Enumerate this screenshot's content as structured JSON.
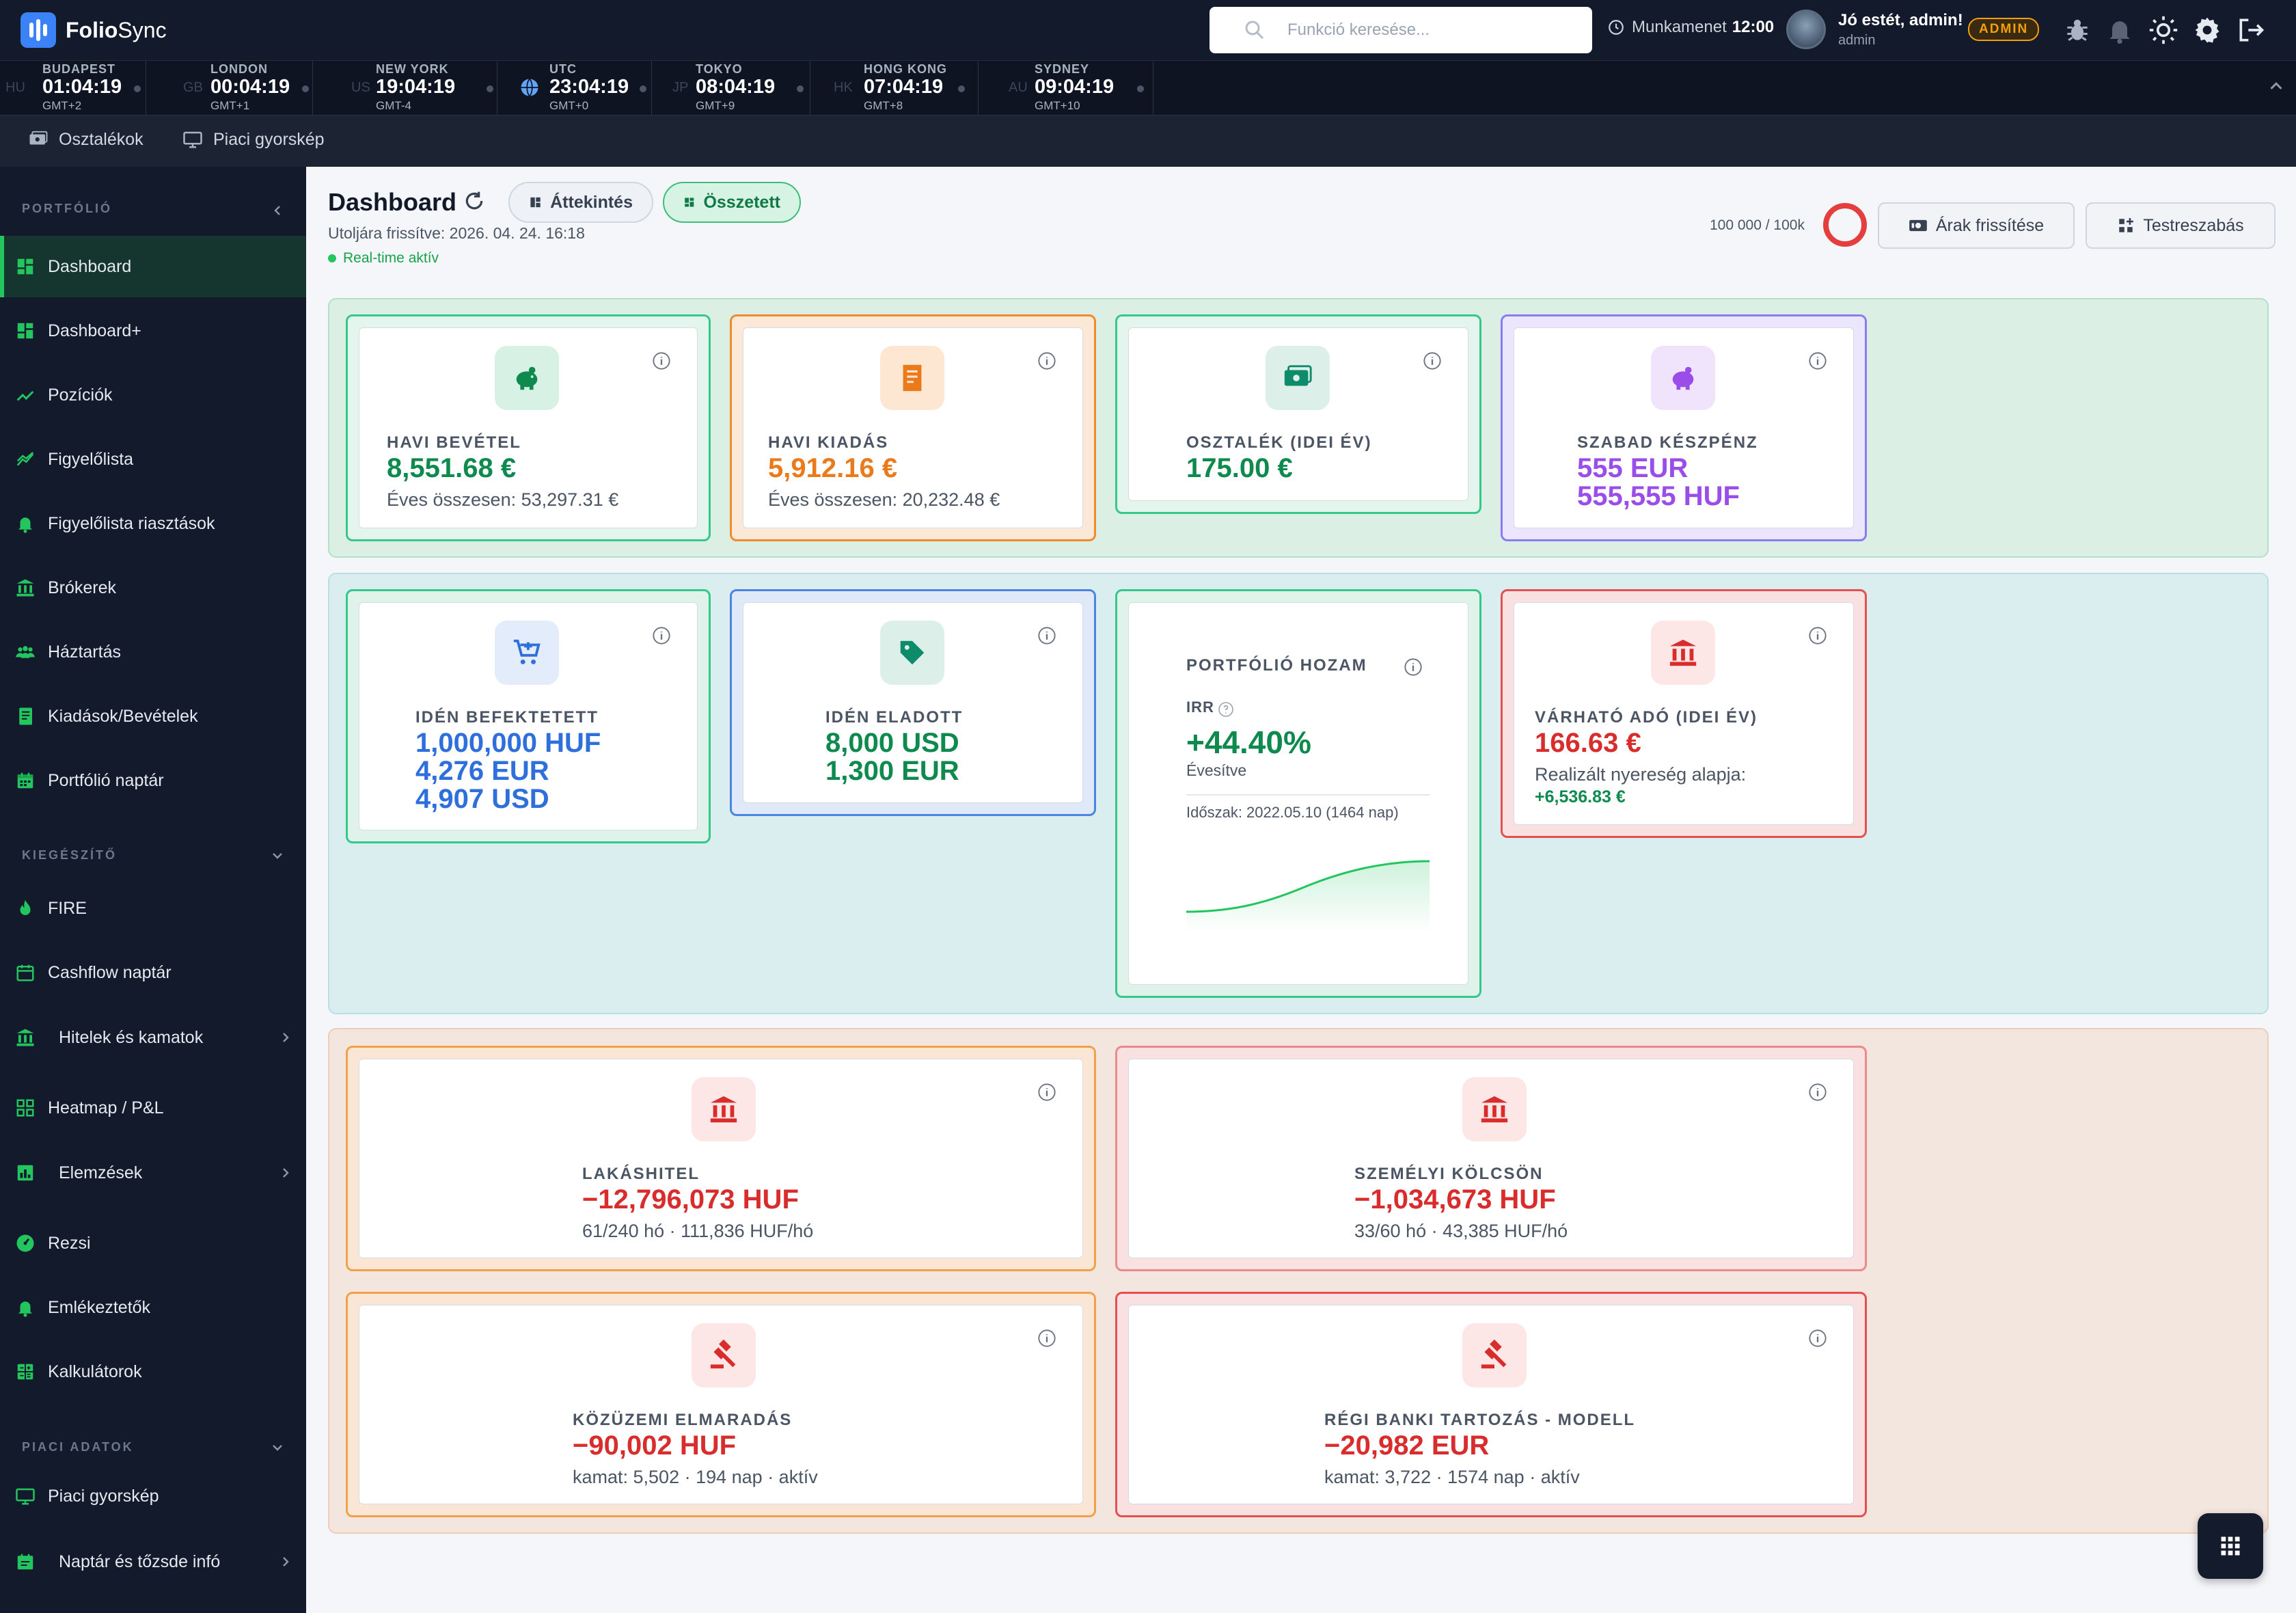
{
  "app": {
    "logo_bold": "Folio",
    "logo_rest": "Sync"
  },
  "search": {
    "placeholder": "Funkció keresése..."
  },
  "session": {
    "label": "Munkamenet",
    "time": "12:00"
  },
  "user": {
    "greeting": "Jó estét, admin!",
    "name": "admin",
    "role": "ADMIN"
  },
  "clocks": [
    {
      "cc": "HU",
      "city": "BUDAPEST",
      "time": "01:04:19",
      "gmt": "GMT+2"
    },
    {
      "cc": "GB",
      "city": "LONDON",
      "time": "00:04:19",
      "gmt": "GMT+1"
    },
    {
      "cc": "US",
      "city": "NEW YORK",
      "time": "19:04:19",
      "gmt": "GMT-4"
    },
    {
      "cc": "",
      "city": "UTC",
      "time": "23:04:19",
      "gmt": "GMT+0"
    },
    {
      "cc": "JP",
      "city": "TOKYO",
      "time": "08:04:19",
      "gmt": "GMT+9"
    },
    {
      "cc": "HK",
      "city": "HONG KONG",
      "time": "07:04:19",
      "gmt": "GMT+8"
    },
    {
      "cc": "AU",
      "city": "SYDNEY",
      "time": "09:04:19",
      "gmt": "GMT+10"
    }
  ],
  "quickbar": {
    "dividends": "Osztalékok",
    "market_snapshot": "Piaci gyorskép"
  },
  "sidebar": {
    "section_portfolio": "PORTFÓLIÓ",
    "section_extra": "KIEGÉSZÍTŐ",
    "section_market": "PIACI ADATOK",
    "items": [
      "Dashboard",
      "Dashboard+",
      "Pozíciók",
      "Figyelőlista",
      "Figyelőlista riasztások",
      "Brókerek",
      "Háztartás",
      "Kiadások/Bevételek",
      "Portfólió naptár",
      "FIRE",
      "Cashflow naptár",
      "Hitelek és kamatok",
      "Heatmap / P&L",
      "Elemzések",
      "Rezsi",
      "Emlékeztetők",
      "Kalkulátorok",
      "Piaci gyorskép",
      "Naptár és tőzsde infó"
    ]
  },
  "header": {
    "title": "Dashboard",
    "tab_overview": "Áttekintés",
    "tab_combined": "Összetett",
    "updated": "Utoljára frissítve: 2026. 04. 24. 16:18",
    "realtime": "Real-time aktív",
    "quota": "100 000 / 100k",
    "refresh_prices": "Árak frissítése",
    "customize": "Testreszabás"
  },
  "cards": {
    "income": {
      "label": "HAVI BEVÉTEL",
      "value": "8,551.68 €",
      "sub": "Éves összesen: 53,297.31 €"
    },
    "expense": {
      "label": "HAVI KIADÁS",
      "value": "5,912.16 €",
      "sub": "Éves összesen: 20,232.48 €"
    },
    "dividend": {
      "label": "OSZTALÉK (IDEI ÉV)",
      "value": "175.00 €"
    },
    "cash": {
      "label": "SZABAD KÉSZPÉNZ",
      "value1": "555 EUR",
      "value2": "555,555 HUF"
    },
    "invested": {
      "label": "IDÉN BEFEKTETETT",
      "v1": "1,000,000 HUF",
      "v2": "4,276 EUR",
      "v3": "4,907 USD"
    },
    "sold": {
      "label": "IDÉN ELADOTT",
      "v1": "8,000 USD",
      "v2": "1,300 EUR"
    },
    "return": {
      "label": "PORTFÓLIÓ HOZAM",
      "irr": "IRR",
      "value": "+44.40%",
      "annual": "Évesítve",
      "period": "Időszak: 2022.05.10 (1464 nap)"
    },
    "tax": {
      "label": "VÁRHATÓ ADÓ (IDEI ÉV)",
      "value": "166.63 €",
      "sub": "Realizált nyereség alapja:",
      "gain": "+6,536.83 €"
    },
    "mortgage": {
      "label": "LAKÁSHITEL",
      "value": "−12,796,073 HUF",
      "sub": "61/240 hó · 111,836 HUF/hó"
    },
    "personal": {
      "label": "SZEMÉLYI KÖLCSÖN",
      "value": "−1,034,673 HUF",
      "sub": "33/60 hó · 43,385 HUF/hó"
    },
    "utility": {
      "label": "KÖZÜZEMI ELMARADÁS",
      "value": "−90,002 HUF",
      "sub": "kamat: 5,502 · 194 nap · aktív"
    },
    "oldbank": {
      "label": "RÉGI BANKI TARTOZÁS - MODELL",
      "value": "−20,982 EUR",
      "sub": "kamat: 3,722 · 1574 nap · aktív"
    }
  },
  "colors": {
    "accent": "#22c55e",
    "topbar": "#131a2b",
    "positive": "#0f8a4f",
    "negative": "#d92d2d"
  }
}
